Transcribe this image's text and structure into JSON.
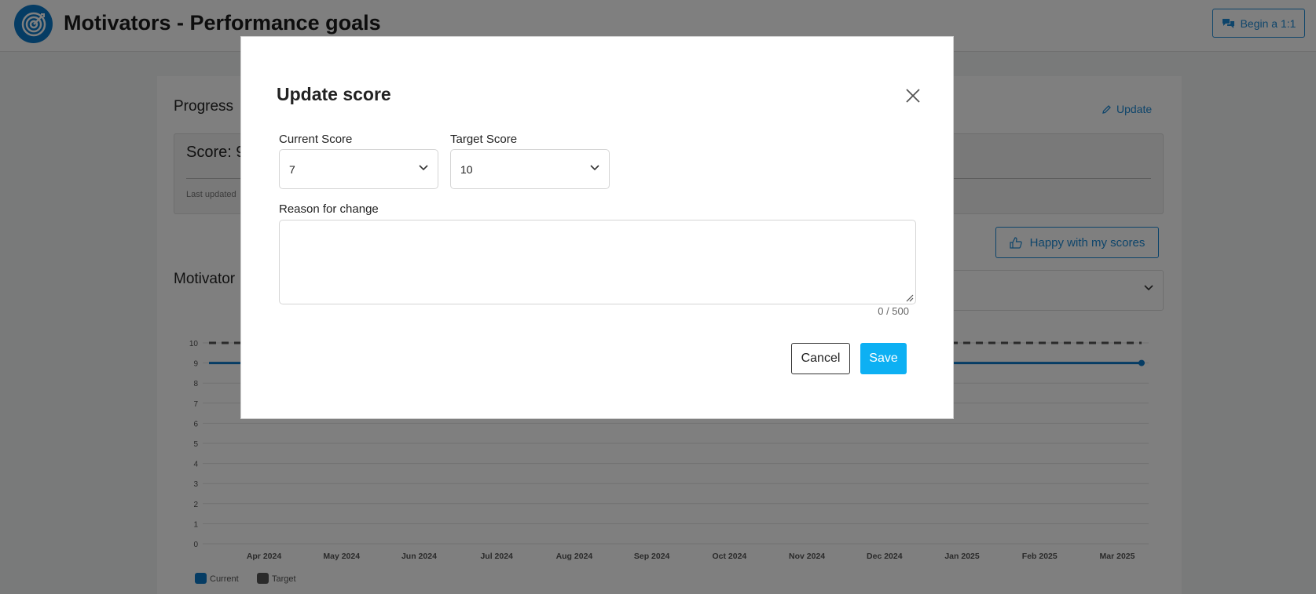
{
  "header": {
    "title": "Motivators - Performance goals",
    "begin_button_label": "Begin a 1:1"
  },
  "progress": {
    "title": "Progress",
    "update_label": "Update",
    "score_text": "Score: 9",
    "last_updated_text": "Last updated"
  },
  "happy_button_label": "Happy with my scores",
  "motivator_title": "Motivator",
  "chart_data": {
    "type": "line",
    "x": [
      "Apr 2024",
      "May 2024",
      "Jun 2024",
      "Jul 2024",
      "Aug 2024",
      "Sep 2024",
      "Oct 2024",
      "Nov 2024",
      "Dec 2024",
      "Jan 2025",
      "Feb 2025",
      "Mar 2025"
    ],
    "ylim": [
      0,
      10
    ],
    "yticks": [
      0,
      1,
      2,
      3,
      4,
      5,
      6,
      7,
      8,
      9,
      10
    ],
    "grid": true,
    "legend_placement": "bottom-left",
    "series": [
      {
        "name": "Current",
        "color": "#0a78c8",
        "style": "solid",
        "values": [
          9,
          9,
          9,
          9,
          9,
          9,
          9,
          9,
          9,
          9,
          9,
          9
        ]
      },
      {
        "name": "Target",
        "color": "#555555",
        "style": "dashed",
        "values": [
          10,
          10,
          10,
          10,
          10,
          10,
          10,
          10,
          10,
          10,
          10,
          10
        ]
      }
    ]
  },
  "modal": {
    "title": "Update score",
    "current_label": "Current Score",
    "current_value": "7",
    "target_label": "Target Score",
    "target_value": "10",
    "reason_label": "Reason for change",
    "reason_value": "",
    "counter": "0 / 500",
    "cancel_label": "Cancel",
    "save_label": "Save"
  },
  "icons": {
    "logo": "target-icon",
    "begin": "chat-bubbles-icon",
    "update": "pencil-icon",
    "happy": "thumbs-up-icon",
    "close": "close-icon",
    "dropdown": "chevron-down-icon"
  },
  "colors": {
    "primary": "#1c8ad6",
    "save": "#0db0f3",
    "overlay": "rgba(0,0,0,0.5)"
  }
}
